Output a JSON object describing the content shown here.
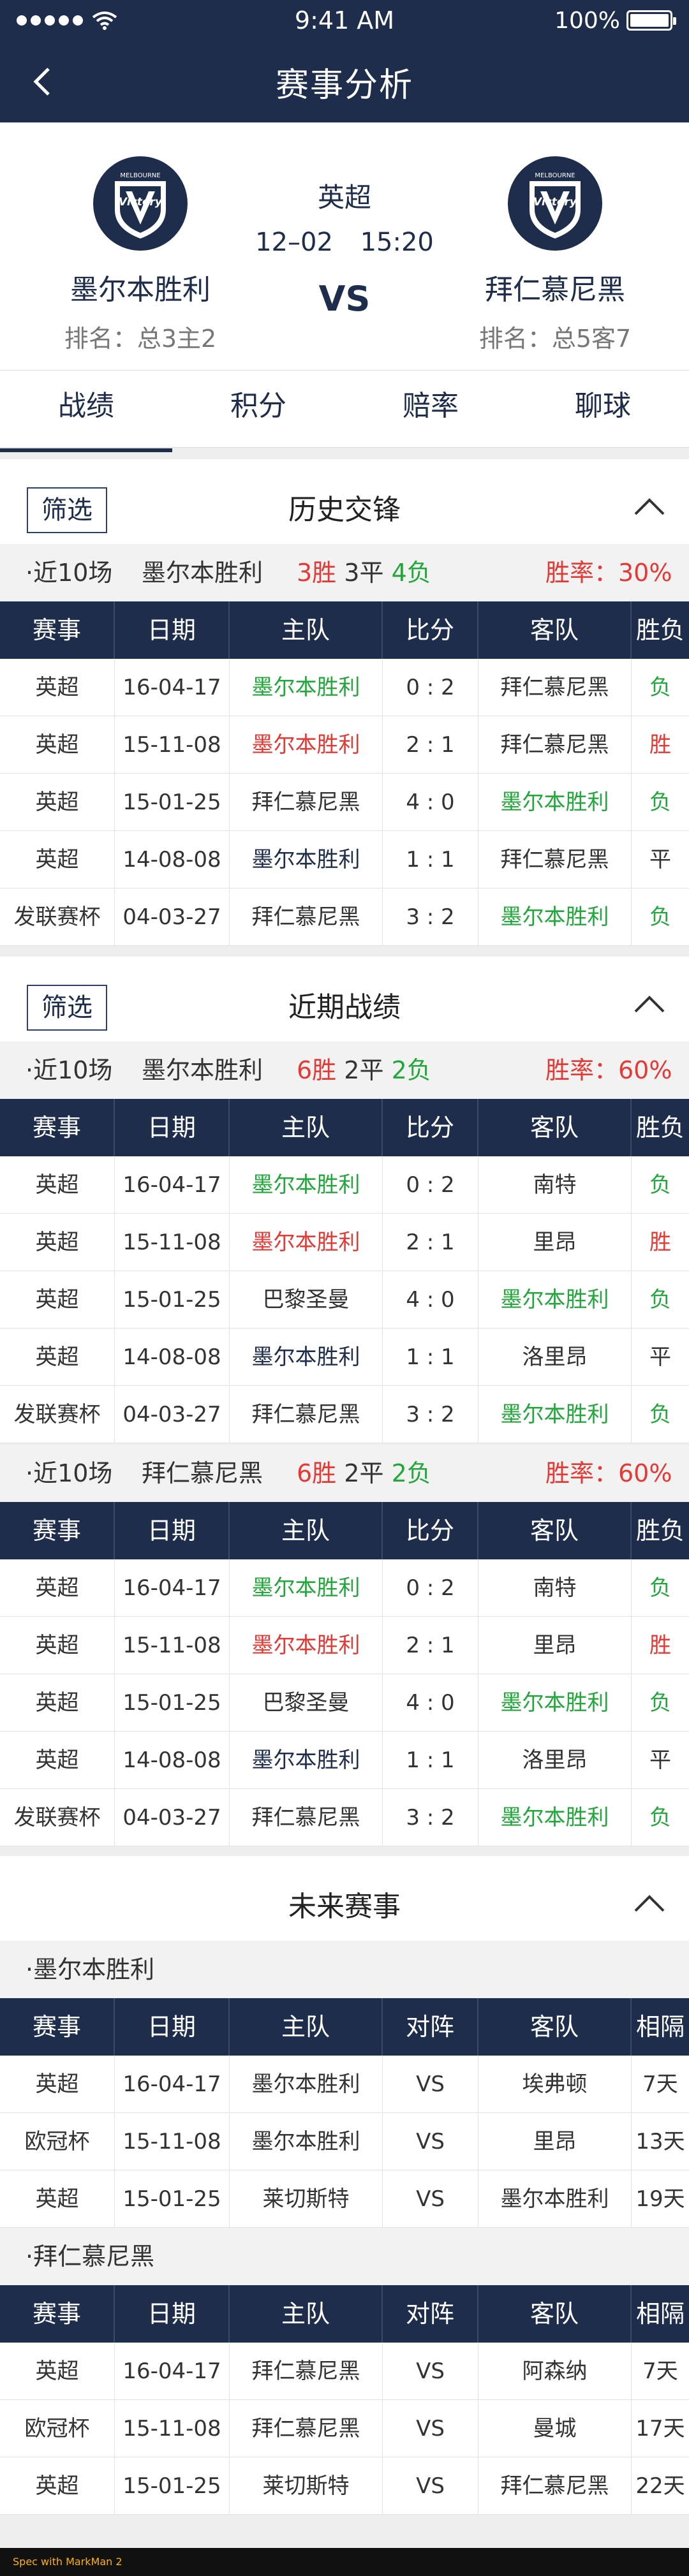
{
  "status": {
    "time": "9:41 AM",
    "battery": "100%",
    "battery_level": 1.0
  },
  "nav": {
    "title": "赛事分析"
  },
  "match": {
    "league": "英超",
    "date": "12–02",
    "time": "15:20",
    "vs": "VS",
    "home": {
      "name": "墨尔本胜利",
      "rank": "排名：总3主2",
      "logo_text": "Victory",
      "logo_small": "MELBOURNE"
    },
    "away": {
      "name": "拜仁慕尼黑",
      "rank": "排名：总5客7",
      "logo_text": "Victory",
      "logo_small": "MELBOURNE"
    }
  },
  "tabs": [
    {
      "label": "战绩",
      "active": true
    },
    {
      "label": "积分",
      "active": false
    },
    {
      "label": "赔率",
      "active": false
    },
    {
      "label": "聊球",
      "active": false
    }
  ],
  "filter_label": "筛选",
  "history": {
    "title": "历史交锋",
    "summary": {
      "range": "·近10场",
      "team": "墨尔本胜利",
      "wins": "3胜",
      "draws": "3平",
      "losses": "4负",
      "rate": "胜率：30%"
    },
    "headers": [
      "赛事",
      "日期",
      "主队",
      "比分",
      "客队",
      "胜负"
    ],
    "rows": [
      {
        "comp": "英超",
        "date": "16-04-17",
        "home": "墨尔本胜利",
        "score": "0 : 2",
        "away": "拜仁慕尼黑",
        "result": "负"
      },
      {
        "comp": "英超",
        "date": "15-11-08",
        "home": "墨尔本胜利",
        "score": "2 : 1",
        "away": "拜仁慕尼黑",
        "result": "胜"
      },
      {
        "comp": "英超",
        "date": "15-01-25",
        "home": "拜仁慕尼黑",
        "score": "4 : 0",
        "away": "墨尔本胜利",
        "result": "负"
      },
      {
        "comp": "英超",
        "date": "14-08-08",
        "home": "墨尔本胜利",
        "score": "1 : 1",
        "away": "拜仁慕尼黑",
        "result": "平"
      },
      {
        "comp": "发联赛杯",
        "date": "04-03-27",
        "home": "拜仁慕尼黑",
        "score": "3 : 2",
        "away": "墨尔本胜利",
        "result": "负"
      }
    ]
  },
  "recent": {
    "title": "近期战绩",
    "home": {
      "summary": {
        "range": "·近10场",
        "team": "墨尔本胜利",
        "wins": "6胜",
        "draws": "2平",
        "losses": "2负",
        "rate": "胜率：60%"
      },
      "headers": [
        "赛事",
        "日期",
        "主队",
        "比分",
        "客队",
        "胜负"
      ],
      "rows": [
        {
          "comp": "英超",
          "date": "16-04-17",
          "home": "墨尔本胜利",
          "score": "0 : 2",
          "away": "南特",
          "result": "负"
        },
        {
          "comp": "英超",
          "date": "15-11-08",
          "home": "墨尔本胜利",
          "score": "2 : 1",
          "away": "里昂",
          "result": "胜"
        },
        {
          "comp": "英超",
          "date": "15-01-25",
          "home": "巴黎圣曼",
          "score": "4 : 0",
          "away": "墨尔本胜利",
          "result": "负"
        },
        {
          "comp": "英超",
          "date": "14-08-08",
          "home": "墨尔本胜利",
          "score": "1 : 1",
          "away": "洛里昂",
          "result": "平"
        },
        {
          "comp": "发联赛杯",
          "date": "04-03-27",
          "home": "拜仁慕尼黑",
          "score": "3 : 2",
          "away": "墨尔本胜利",
          "result": "负"
        }
      ]
    },
    "away": {
      "summary": {
        "range": "·近10场",
        "team": "拜仁慕尼黑",
        "wins": "6胜",
        "draws": "2平",
        "losses": "2负",
        "rate": "胜率：60%"
      },
      "headers": [
        "赛事",
        "日期",
        "主队",
        "比分",
        "客队",
        "胜负"
      ],
      "rows": [
        {
          "comp": "英超",
          "date": "16-04-17",
          "home": "墨尔本胜利",
          "score": "0 : 2",
          "away": "南特",
          "result": "负"
        },
        {
          "comp": "英超",
          "date": "15-11-08",
          "home": "墨尔本胜利",
          "score": "2 : 1",
          "away": "里昂",
          "result": "胜"
        },
        {
          "comp": "英超",
          "date": "15-01-25",
          "home": "巴黎圣曼",
          "score": "4 : 0",
          "away": "墨尔本胜利",
          "result": "负"
        },
        {
          "comp": "英超",
          "date": "14-08-08",
          "home": "墨尔本胜利",
          "score": "1 : 1",
          "away": "洛里昂",
          "result": "平"
        },
        {
          "comp": "发联赛杯",
          "date": "04-03-27",
          "home": "拜仁慕尼黑",
          "score": "3 : 2",
          "away": "墨尔本胜利",
          "result": "负"
        }
      ]
    }
  },
  "future": {
    "title": "未来赛事",
    "home": {
      "label": "·墨尔本胜利",
      "headers": [
        "赛事",
        "日期",
        "主队",
        "对阵",
        "客队",
        "相隔"
      ],
      "rows": [
        {
          "comp": "英超",
          "date": "16-04-17",
          "home": "墨尔本胜利",
          "vs": "VS",
          "away": "埃弗顿",
          "gap": "7天"
        },
        {
          "comp": "欧冠杯",
          "date": "15-11-08",
          "home": "墨尔本胜利",
          "vs": "VS",
          "away": "里昂",
          "gap": "13天"
        },
        {
          "comp": "英超",
          "date": "15-01-25",
          "home": "莱切斯特",
          "vs": "VS",
          "away": "墨尔本胜利",
          "gap": "19天"
        }
      ]
    },
    "away": {
      "label": "·拜仁慕尼黑",
      "headers": [
        "赛事",
        "日期",
        "主队",
        "对阵",
        "客队",
        "相隔"
      ],
      "rows": [
        {
          "comp": "英超",
          "date": "16-04-17",
          "home": "拜仁慕尼黑",
          "vs": "VS",
          "away": "阿森纳",
          "gap": "7天"
        },
        {
          "comp": "欧冠杯",
          "date": "15-11-08",
          "home": "拜仁慕尼黑",
          "vs": "VS",
          "away": "曼城",
          "gap": "17天"
        },
        {
          "comp": "英超",
          "date": "15-01-25",
          "home": "莱切斯特",
          "vs": "VS",
          "away": "拜仁慕尼黑",
          "gap": "22天"
        }
      ]
    }
  },
  "footer": {
    "text": "Spec with MarkMan 2"
  },
  "colors": {
    "navy": "#1e2d4b",
    "win_red": "#e53935",
    "loss_green": "#22a83a"
  }
}
